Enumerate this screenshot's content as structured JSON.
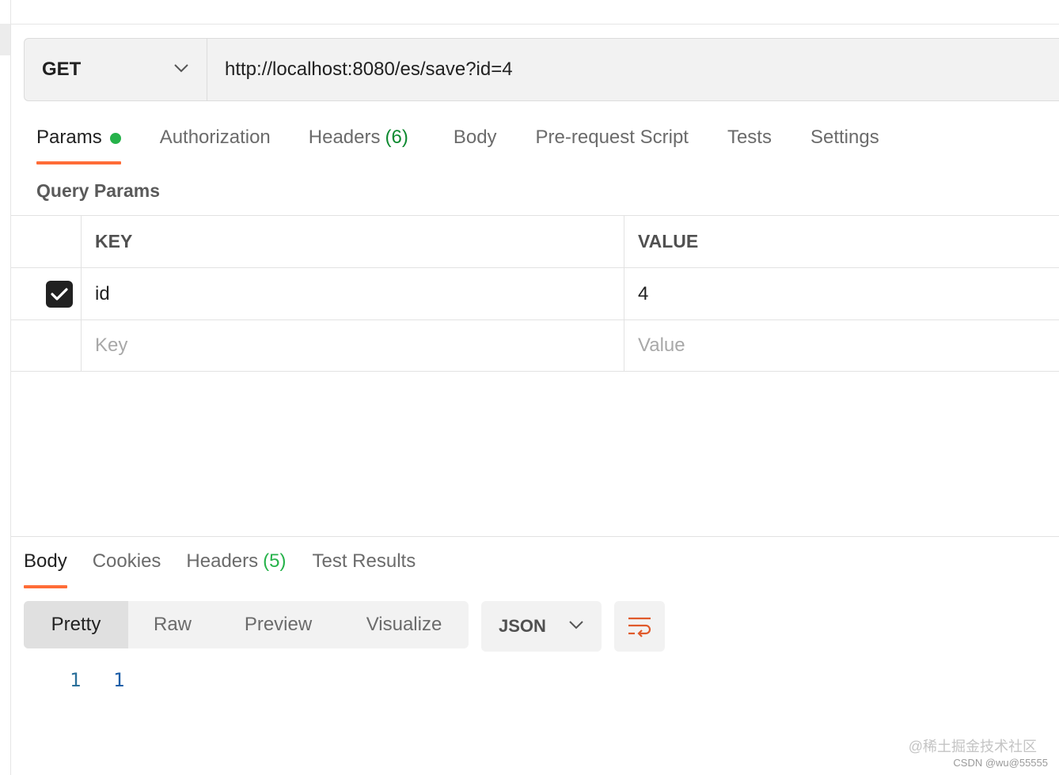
{
  "request": {
    "method": "GET",
    "url": "http://localhost:8080/es/save?id=4"
  },
  "request_tabs": [
    {
      "label": "Params",
      "count": "",
      "active": true,
      "indicator": true
    },
    {
      "label": "Authorization",
      "count": ""
    },
    {
      "label": "Headers",
      "count": "(6)"
    },
    {
      "label": "Body",
      "count": ""
    },
    {
      "label": "Pre-request Script",
      "count": ""
    },
    {
      "label": "Tests",
      "count": ""
    },
    {
      "label": "Settings",
      "count": ""
    }
  ],
  "query_params": {
    "title": "Query Params",
    "headers": {
      "key": "KEY",
      "value": "VALUE"
    },
    "rows": [
      {
        "checked": true,
        "key": "id",
        "value": "4"
      }
    ],
    "placeholder": {
      "key": "Key",
      "value": "Value"
    }
  },
  "response_tabs": [
    {
      "label": "Body",
      "count": "",
      "active": true
    },
    {
      "label": "Cookies",
      "count": ""
    },
    {
      "label": "Headers",
      "count": "(5)"
    },
    {
      "label": "Test Results",
      "count": ""
    }
  ],
  "view_modes": [
    "Pretty",
    "Raw",
    "Preview",
    "Visualize"
  ],
  "active_view": "Pretty",
  "format": "JSON",
  "response_body": {
    "line_number": "1",
    "content": "1"
  },
  "colors": {
    "accent": "#ff6c37",
    "indicator": "#26b24a",
    "count": "#0f8a31",
    "wrap_icon": "#e05a2b"
  },
  "watermark": {
    "line1": "@稀土掘金技术社区",
    "line2": "CSDN @wu@55555"
  }
}
